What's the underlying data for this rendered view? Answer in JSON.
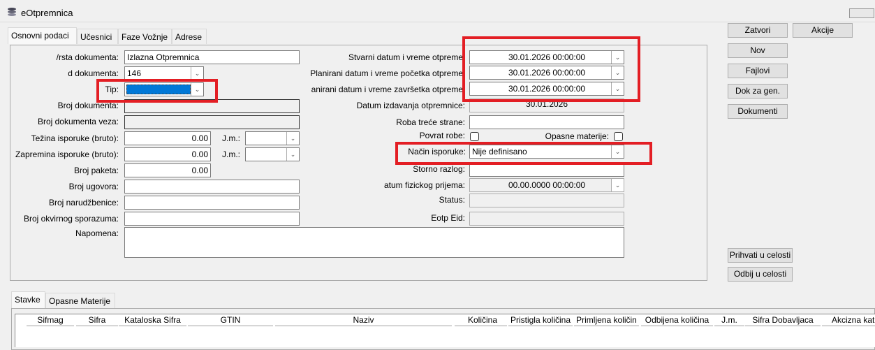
{
  "window": {
    "title": "eOtpremnica"
  },
  "tabs": [
    {
      "label": "Osnovni podaci"
    },
    {
      "label": "Učesnici"
    },
    {
      "label": "Faze Vožnje"
    },
    {
      "label": "Adrese"
    }
  ],
  "left": {
    "vrsta_label": "/rsta dokumenta:",
    "vrsta_value": "Izlazna Otpremnica",
    "id_label": "d dokumenta:",
    "id_value": "146",
    "tip_label": "Tip:",
    "tip_value": "",
    "broj_label": "Broj dokumenta:",
    "broj_value": "",
    "veza_label": "Broj dokumenta veza:",
    "veza_value": "",
    "tezina_label": "Težina isporuke (bruto):",
    "tezina_value": "0.00",
    "jm_label": "J.m.:",
    "zapremina_label": "Zapremina isporuke (bruto):",
    "zapremina_value": "0.00",
    "jm2_label": "J.m.:",
    "paketa_label": "Broj paketa:",
    "paketa_value": "0.00",
    "ugovora_label": "Broj ugovora:",
    "ugovora_value": "",
    "narudzbenice_label": "Broj narudžbenice:",
    "narudzbenice_value": "",
    "okvirnog_label": "Broj okvirnog sporazuma:",
    "okvirnog_value": "",
    "napomena_label": "Napomena:",
    "napomena_value": ""
  },
  "right": {
    "stvarni_label": "Stvarni datum i vreme otpreme",
    "stvarni_value": "30.01.2026 00:00:00",
    "pocetak_label": "Planirani datum i vreme početka otpreme",
    "pocetak_value": "30.01.2026 00:00:00",
    "zavrsetak_label": "anirani datum i vreme završetka otpreme",
    "zavrsetak_value": "30.01.2026 00:00:00",
    "izdavanja_label": "Datum izdavanja otpremnice:",
    "izdavanja_value": "30.01.2026",
    "roba_label": "Roba treće strane:",
    "roba_value": "",
    "povrat_label": "Povrat robe:",
    "opasne_label": "Opasne materije:",
    "nacin_label": "Način isporuke:",
    "nacin_value": "Nije definisano",
    "storno_label": "Storno razlog:",
    "storno_value": "",
    "prijem_label": "atum fizickog prijema:",
    "prijem_value": "00.00.0000 00:00:00",
    "status_label": "Status:",
    "status_value": "",
    "eid_label": "Eotp Eid:",
    "eid_value": ""
  },
  "buttons": {
    "zatvori": "Zatvori",
    "akcije": "Akcije",
    "nov": "Nov",
    "fajlovi": "Fajlovi",
    "dok_za_gen": "Dok za gen.",
    "dokumenti": "Dokumenti",
    "prihvati": "Prihvati u celosti",
    "odbij": "Odbij u celosti"
  },
  "bottom_tabs": [
    {
      "label": "Stavke"
    },
    {
      "label": "Opasne Materije"
    }
  ],
  "table": {
    "columns": [
      "Sifmag",
      "Sifra",
      "Kataloska Sifra",
      "GTIN",
      "Naziv",
      "Količina",
      "Pristigla količina",
      "Primljena količin",
      "Odbijena količina",
      "J.m.",
      "Sifra Dobavljaca",
      "Akcizna kat"
    ]
  },
  "colors": {
    "highlight": "#e31e24",
    "selection": "#0078d7"
  }
}
